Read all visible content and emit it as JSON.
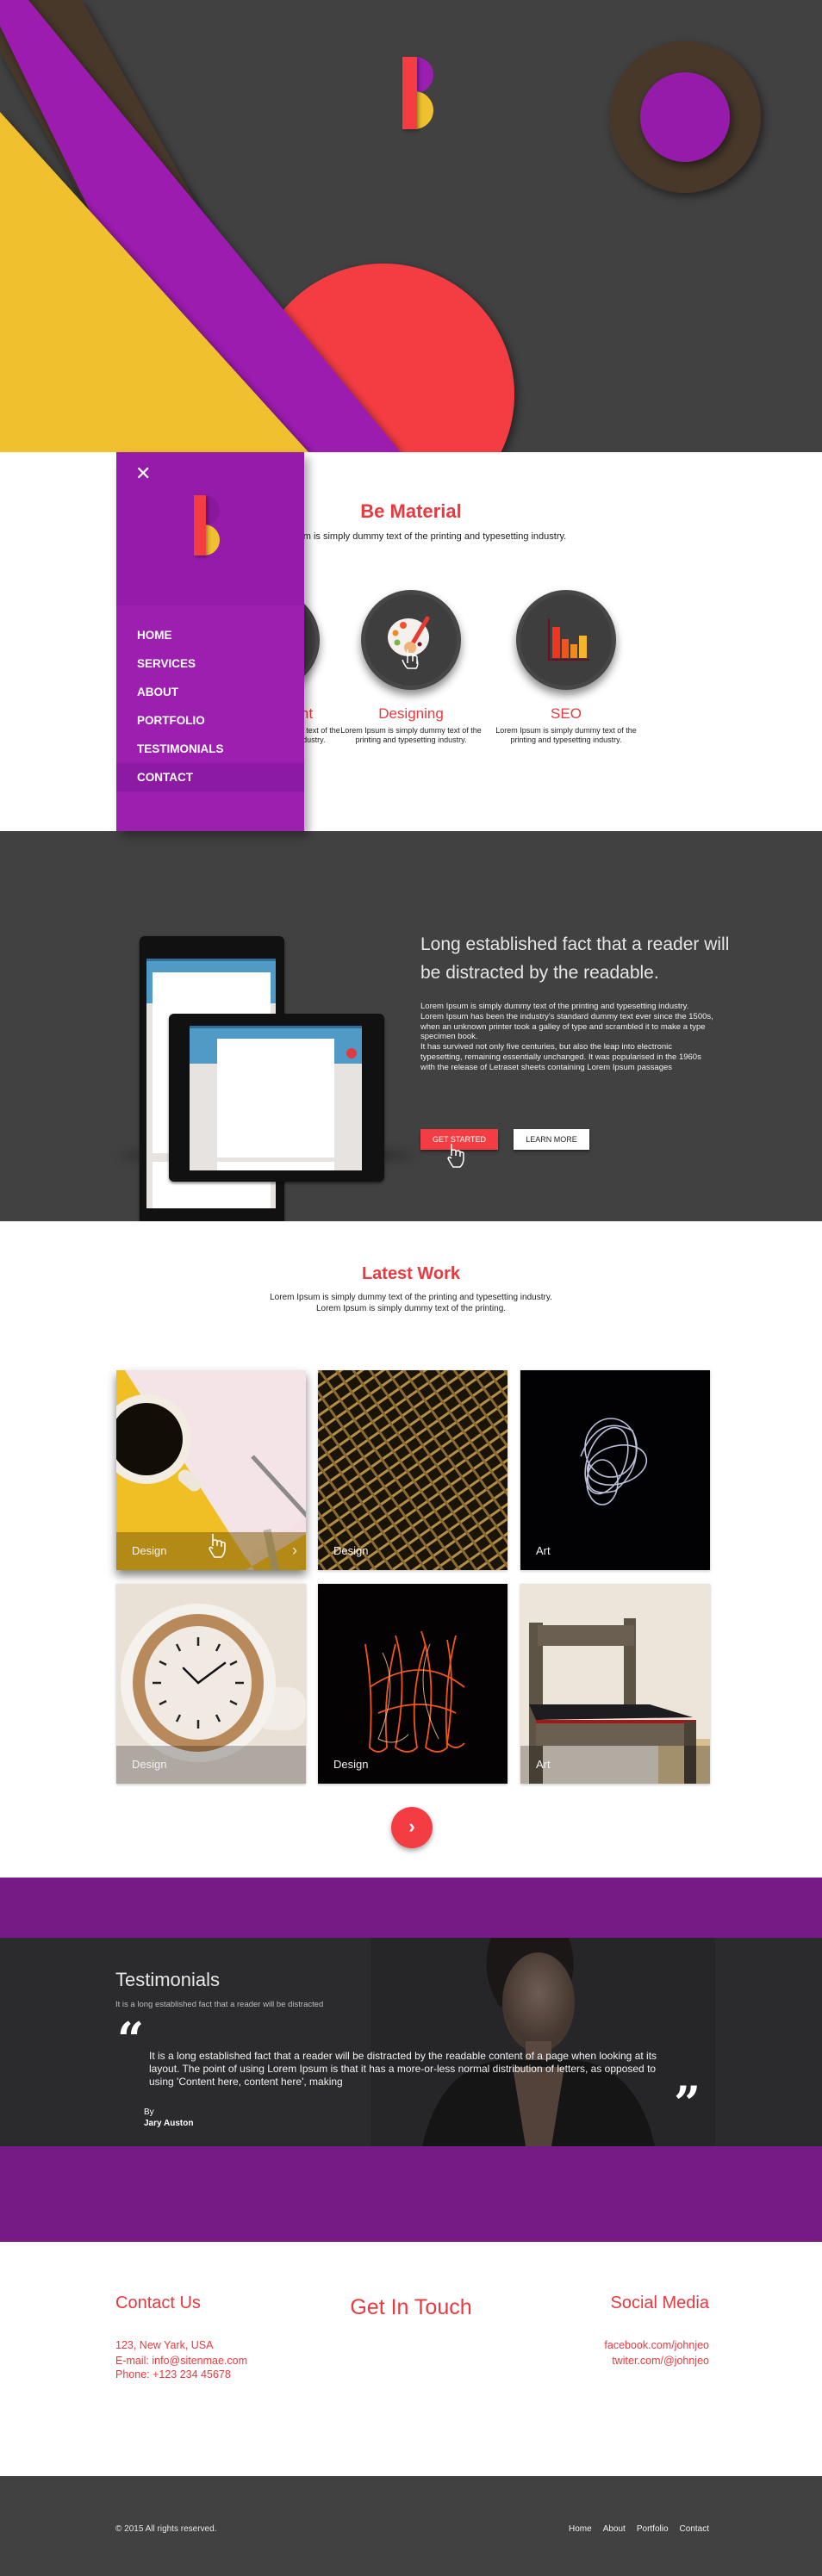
{
  "colors": {
    "accent_red": "#f43c43",
    "brand_purple": "#9c1fb0",
    "band_purple": "#761b85",
    "accent_yellow": "#f0c02f",
    "dark_gray": "#414141",
    "brown": "#47382a"
  },
  "sidebar": {
    "close_icon": "close-icon",
    "logo": "B",
    "items": [
      {
        "label": "HOME"
      },
      {
        "label": "SERVICES"
      },
      {
        "label": "ABOUT"
      },
      {
        "label": "PORTFOLIO"
      },
      {
        "label": "TESTIMONIALS"
      },
      {
        "label": "CONTACT",
        "active": true
      }
    ]
  },
  "services": {
    "title": "Be Material",
    "subtitle": "Lorem Ipsum is simply dummy text of the printing and typesetting industry.",
    "items": [
      {
        "name": "Development",
        "desc": "Lorem Ipsum is simply dummy text of the printing and typesetting industry.",
        "icon": "code-icon"
      },
      {
        "name": "Designing",
        "desc": "Lorem Ipsum is simply dummy text of the printing and typesetting industry.",
        "icon": "palette-icon"
      },
      {
        "name": "SEO",
        "desc": "Lorem Ipsum is simply dummy text of the printing and typesetting industry.",
        "icon": "bar-chart-icon"
      }
    ]
  },
  "promo": {
    "heading": "Long established fact that a reader will be distracted by the readable.",
    "body": "Lorem Ipsum is simply dummy text of the printing and typesetting industry. Lorem Ipsum has been the industry's standard dummy text ever since the 1500s, when an unknown printer took a galley of type and scrambled it to make a type specimen book.",
    "body2": "It has survived not only five centuries, but also the leap into electronic typesetting, remaining essentially unchanged. It was popularised in the 1960s with the release of Letraset sheets containing Lorem Ipsum passages",
    "primary_button": "GET STARTED",
    "secondary_button": "LEARN MORE"
  },
  "work": {
    "title": "Latest Work",
    "subtitle_line1": "Lorem Ipsum is simply dummy text of the printing and typesetting industry.",
    "subtitle_line2": "Lorem Ipsum is simply dummy text of the printing.",
    "tiles": [
      {
        "caption": "Design",
        "image": "coffee cup and pen on yellow paper"
      },
      {
        "caption": "Design",
        "image": "golden metal mesh"
      },
      {
        "caption": "Art",
        "image": "white light painting on black"
      },
      {
        "caption": "Design",
        "image": "latte clock"
      },
      {
        "caption": "Design",
        "image": "orange light painting on black"
      },
      {
        "caption": "Art",
        "image": "old wooden chair"
      }
    ],
    "next_icon": "chevron-right-icon"
  },
  "testimonials": {
    "title": "Testimonials",
    "subtitle": "It is a long established fact that a reader will be distracted",
    "quote": "It is a long established fact that a reader will be distracted by the readable content of a page when looking at its layout. The point of using Lorem Ipsum is that it has a more-or-less normal distribution of letters, as opposed to using 'Content here, content here', making",
    "open_quote": "“",
    "close_quote": "”",
    "by_label": "By",
    "author": "Jary Auston"
  },
  "contact": {
    "left_title": "Contact Us",
    "address": "123, New Yark, USA",
    "email": "E-mail: info@sitenmae.com",
    "phone": "Phone: +123 234 45678",
    "center_title": "Get In Touch",
    "right_title": "Social Media",
    "facebook": "facebook.com/johnjeo",
    "twitter": "twiter.com/@johnjeo"
  },
  "footer": {
    "copyright": "© 2015 All rights reserved.",
    "links": [
      "Home",
      "About",
      "Portfolio",
      "Contact"
    ]
  }
}
